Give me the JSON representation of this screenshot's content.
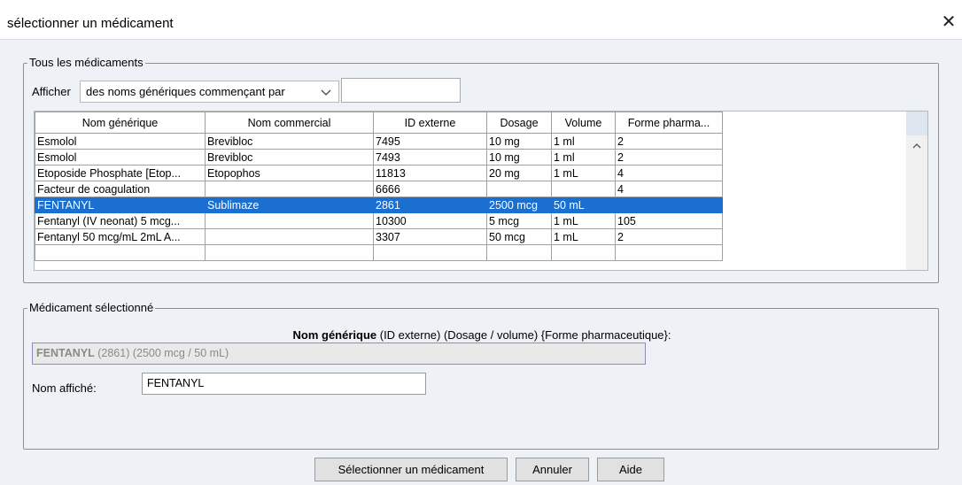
{
  "window": {
    "title": "sélectionner un médicament",
    "close_glyph": "✕"
  },
  "all_meds": {
    "legend": "Tous les médicaments",
    "afficher_label": "Afficher",
    "filter_select_value": "des noms génériques commençant par",
    "filter_text": "",
    "columns": [
      "Nom générique",
      "Nom commercial",
      "ID externe",
      "Dosage",
      "Volume",
      "Forme pharma..."
    ],
    "rows": [
      [
        "Esmolol",
        "Brevibloc",
        "7495",
        "10 mg",
        "1 ml",
        "2"
      ],
      [
        "Esmolol",
        "Brevibloc",
        "7493",
        "10 mg",
        "1 ml",
        "2"
      ],
      [
        "Etoposide Phosphate [Etop...",
        "Etopophos",
        "11813",
        "20 mg",
        "1 mL",
        "4"
      ],
      [
        "Facteur de coagulation",
        "",
        "6666",
        "",
        "",
        "4"
      ],
      [
        "FENTANYL",
        "Sublimaze",
        "2861",
        "2500 mcg",
        "50 mL",
        ""
      ],
      [
        "Fentanyl (IV neonat) 5 mcg...",
        "",
        "10300",
        "5 mcg",
        "1 mL",
        "105"
      ],
      [
        "Fentanyl 50 mcg/mL 2mL A...",
        "",
        "3307",
        "50 mcg",
        "1 mL",
        "2"
      ],
      [
        "",
        "",
        "",
        "",
        "",
        ""
      ]
    ],
    "selected_row_index": 4
  },
  "selected_med": {
    "legend": "Médicament sélectionné",
    "caption_bold": "Nom générique",
    "caption_rest": " (ID externe) (Dosage / volume) {Forme pharmaceutique}:",
    "summary_bold": "FENTANYL",
    "summary_rest": " (2861) (2500 mcg / 50 mL)",
    "display_name_label": "Nom affiché:",
    "display_name_value": "FENTANYL"
  },
  "buttons": {
    "select": "Sélectionner un médicament",
    "cancel": "Annuler",
    "help": "Aide"
  },
  "colors": {
    "selection": "#1b6fd1",
    "client_bg": "#eef1f6"
  }
}
